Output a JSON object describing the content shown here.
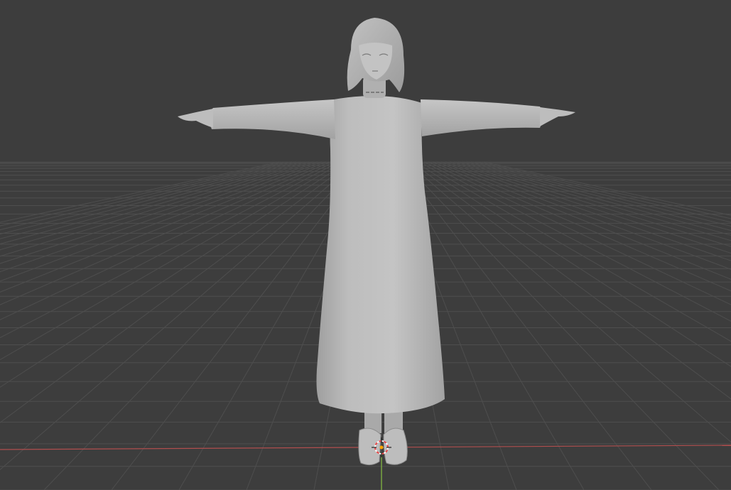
{
  "viewport": {
    "background_color": "#3d3d3d",
    "grid_color": "#4e4e4e",
    "x_axis_color": "#c85a5a",
    "y_axis_color": "#8bc34a",
    "model_color": "#b9b9b9",
    "model_shadow_color": "#9a9a9a",
    "cursor_colors": [
      "#e84a4a",
      "#ffffff"
    ],
    "object": "t-pose-character-model",
    "icons": [
      "3d-cursor-icon",
      "origin-point-icon"
    ]
  }
}
